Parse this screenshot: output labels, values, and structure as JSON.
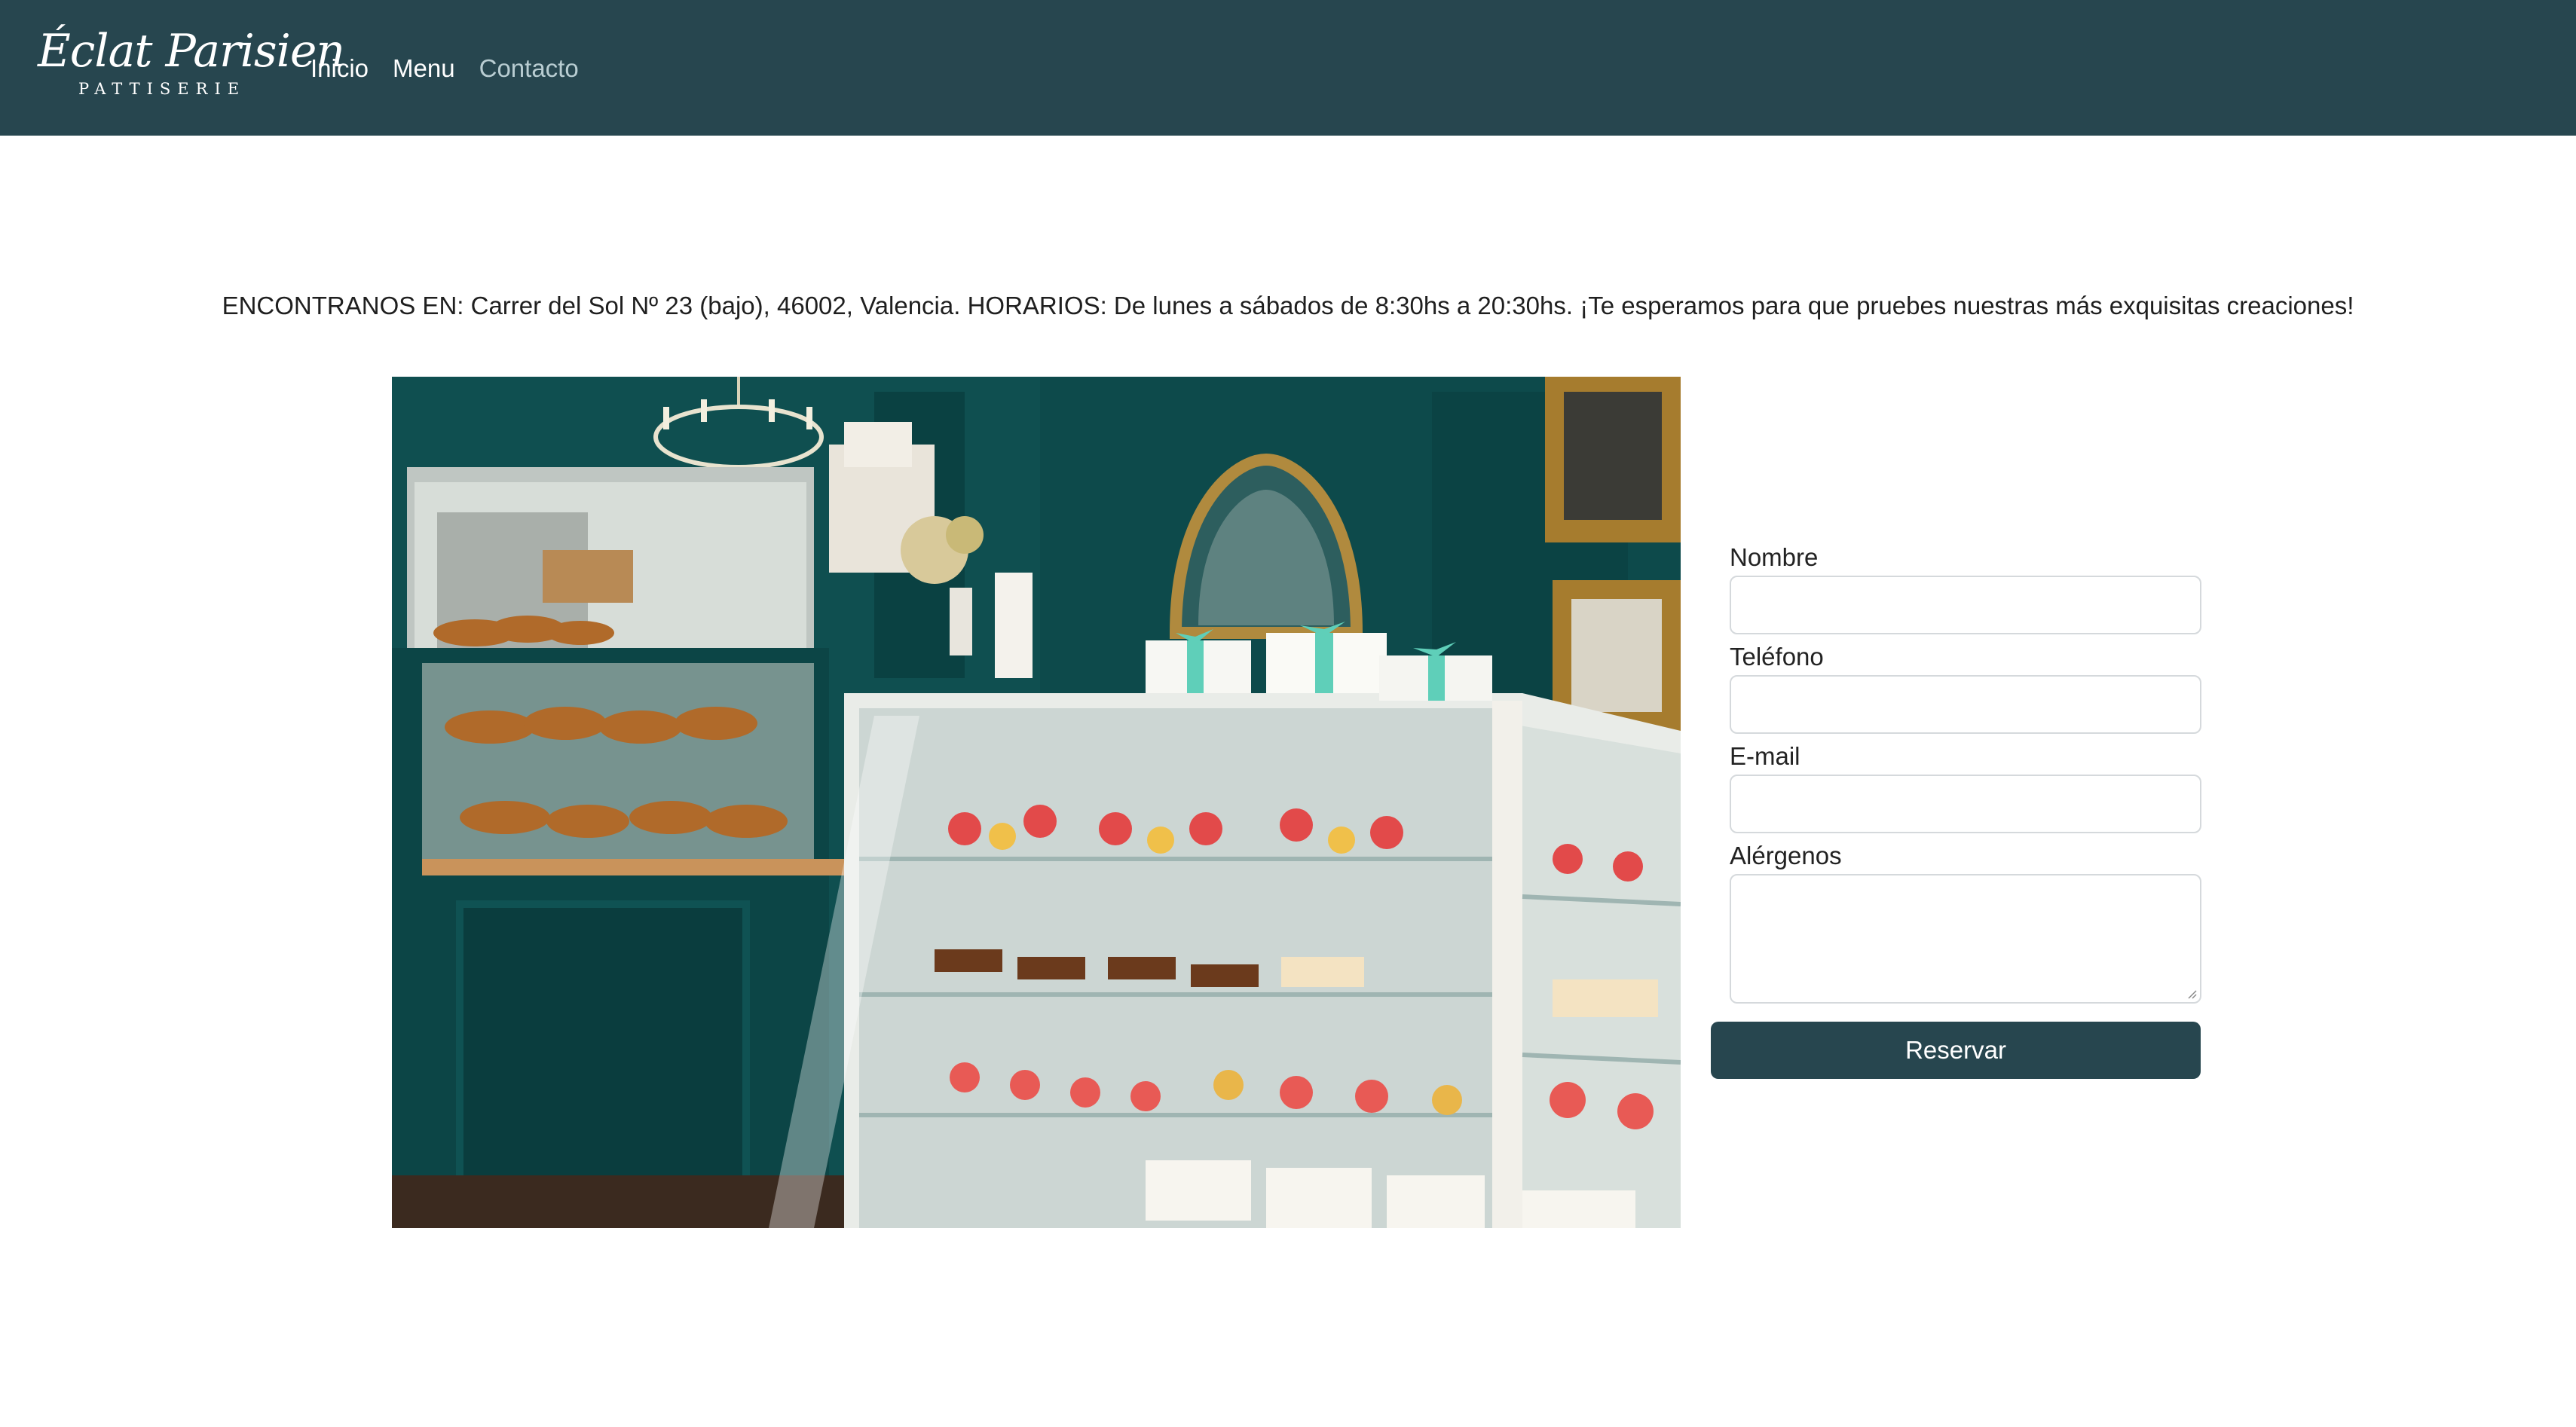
{
  "brand": {
    "script": "Éclat Parisien",
    "sub": "PATTISERIE"
  },
  "nav": {
    "items": [
      {
        "label": "Inicio"
      },
      {
        "label": "Menu"
      },
      {
        "label": "Contacto"
      }
    ]
  },
  "info": {
    "text": "ENCONTRANOS EN: Carrer del Sol Nº 23 (bajo), 46002, Valencia. HORARIOS: De lunes a sábados de 8:30hs a 20:30hs. ¡Te esperamos para que pruebes nuestras más exquisitas creaciones!"
  },
  "form": {
    "fields": [
      {
        "label": "Nombre",
        "value": ""
      },
      {
        "label": "Teléfono",
        "value": ""
      },
      {
        "label": "E-mail",
        "value": ""
      },
      {
        "label": "Alérgenos",
        "value": ""
      }
    ],
    "submit_label": "Reservar"
  },
  "colors": {
    "navbar": "#27464f",
    "active_link": "#b9cdd2",
    "button": "#27464f"
  }
}
